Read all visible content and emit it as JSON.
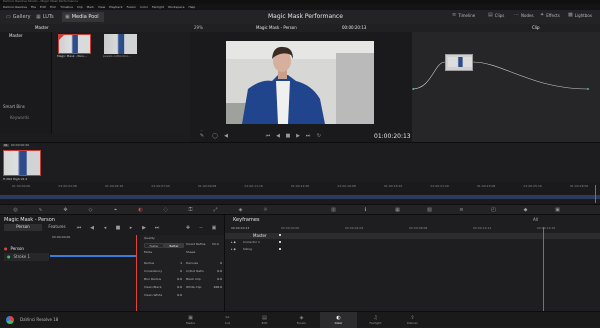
{
  "titlebar": "DaVinci Resolve Studio - Magic Mask Performance",
  "menu": [
    "DaVinci Resolve",
    "File",
    "Edit",
    "Trim",
    "Timeline",
    "Clip",
    "Mark",
    "View",
    "Playback",
    "Fusion",
    "Color",
    "Fairlight",
    "Workspace",
    "Help"
  ],
  "toolbar": {
    "gallery": "Gallery",
    "luts": "LUTs",
    "media_pool": "Media Pool",
    "project": "Magic Mask Performance",
    "timeline": "Timeline",
    "clips": "Clips",
    "nodes": "Nodes",
    "effects": "Effects",
    "lightbox": "Lightbox",
    "clip_label": "Clip"
  },
  "media": {
    "folder": "Master",
    "smart_bins": "Smart Bins",
    "keywords": "Keywords",
    "clips": [
      {
        "name": "Magic Mask - Pers..."
      },
      {
        "name": "pexels-cottonbro..."
      }
    ]
  },
  "viewer": {
    "zoom": "29%",
    "clip_title": "Magic Mask - Person",
    "timecode_top": "00:00:20:13",
    "timecode": "01:00:20:13"
  },
  "timeline": {
    "clip_num": "01",
    "clip_tc": "00:00:00:00",
    "clip_v": "V1",
    "codec": "H.264 High L5.2",
    "ruler": [
      "01:00:00:00",
      "01:00:02:08",
      "01:00:04:16",
      "01:00:07:00",
      "01:00:09:08",
      "01:00:11:16",
      "01:00:14:00",
      "01:00:16:08",
      "01:00:18:16",
      "01:00:21:00",
      "01:00:23:08",
      "01:00:25:16",
      "01:00:28:00"
    ]
  },
  "magic_mask": {
    "title": "Magic Mask - Person",
    "tab_person": "Person",
    "tab_features": "Features",
    "track_tc": "00:00:00:00",
    "strokes": "Person",
    "stroke1": "Stroke 1",
    "quality_label": "Quality",
    "faster": "Faster",
    "better": "Better",
    "smart_refine_label": "Smart Refine",
    "smart_refine": "50.0",
    "mode_label": "Mode",
    "shape_label": "Shape",
    "params": [
      {
        "l": "Radius",
        "v": "1"
      },
      {
        "l": "Consistency",
        "v": "0"
      },
      {
        "l": "Blur Radius",
        "v": "0.0"
      },
      {
        "l": "Clean Black",
        "v": "0.0"
      },
      {
        "l": "Clean White",
        "v": "0.0"
      }
    ],
    "params2": [
      {
        "l": "Denoise",
        "v": "0"
      },
      {
        "l": "In/Out Ratio",
        "v": "0.0"
      },
      {
        "l": "Black Clip",
        "v": "0.0"
      },
      {
        "l": "White Clip",
        "v": "100.0"
      }
    ]
  },
  "keyframes": {
    "title": "Keyframes",
    "all": "All",
    "tc": "00:00:20:13",
    "master": "Master",
    "corrector": "Corrector 1",
    "sizing": "Sizing",
    "ruler": [
      "00:00:00:00",
      "00:00:04:04",
      "00:00:08:08",
      "00:00:12:12",
      "00:00:16:16"
    ]
  },
  "pages": [
    "Media",
    "Cut",
    "Edit",
    "Fusion",
    "Color",
    "Fairlight",
    "Deliver"
  ],
  "active_page": "Color",
  "brand": "DaVinci Resolve 18"
}
